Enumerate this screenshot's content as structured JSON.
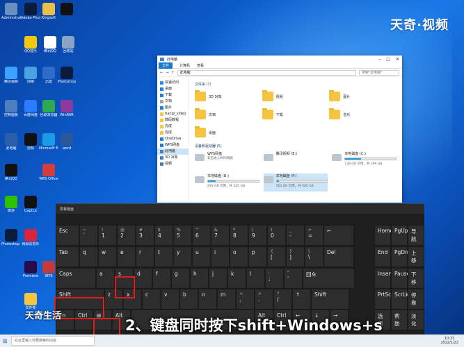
{
  "watermark": "天奇·视频",
  "caption": "2、键盘同时按下shift+Windows+s",
  "brand_logo": "天奇生活",
  "desktop_icons": [
    {
      "label": "Administrator",
      "color": "#6a8fbf"
    },
    {
      "label": "Adobe Photoshop",
      "color": "#0b1b3a"
    },
    {
      "label": "Kingsoft",
      "color": "#e8c04a"
    },
    {
      "label": "",
      "color": "#111111"
    },
    {
      "label": "QQ音乐",
      "color": "#f2c80f"
    },
    {
      "label": "腾讯QQ",
      "color": "#ffffff"
    },
    {
      "label": "回收站",
      "color": "#8aa4c4"
    },
    {
      "label": "腾讯视频",
      "color": "#3ba3ff"
    },
    {
      "label": "网络",
      "color": "#4aa3df"
    },
    {
      "label": "迅雷",
      "color": "#2f6cc9"
    },
    {
      "label": "Photoshop",
      "color": "#0b1b3a"
    },
    {
      "label": "控制面板",
      "color": "#4d7fbf"
    },
    {
      "label": "百度网盘",
      "color": "#2d7bff"
    },
    {
      "label": "谷歌浏览器",
      "color": "#2fa84f"
    },
    {
      "label": "WinRAR",
      "color": "#8a3a9c"
    },
    {
      "label": "此电脑",
      "color": "#2a5fa8"
    },
    {
      "label": "剪映",
      "color": "#111111"
    },
    {
      "label": "Microsoft Edge",
      "color": "#1a9be6"
    },
    {
      "label": "word",
      "color": "#2b579a"
    },
    {
      "label": "腾讯QQ",
      "color": "#111111"
    },
    {
      "label": "WPS Office",
      "color": "#d63c3c"
    },
    {
      "label": "CapCut",
      "color": "#111111"
    },
    {
      "label": "微信",
      "color": "#2dc100"
    },
    {
      "label": "网易云音乐",
      "color": "#d7263d"
    },
    {
      "label": "Photoshop 2020",
      "color": "#0b1b3a"
    },
    {
      "label": "Premiere",
      "color": "#2a0a4a"
    },
    {
      "label": "WPS",
      "color": "#c43a3a"
    },
    {
      "label": "文件夹",
      "color": "#f5c542"
    }
  ],
  "explorer": {
    "title": "此电脑",
    "ribbon": {
      "file": "文件",
      "computer": "计算机",
      "view": "查看"
    },
    "address": "此电脑",
    "search_placeholder": "搜索\"此电脑\"",
    "nav": [
      {
        "label": "快速访问",
        "color": "#3b8fe0"
      },
      {
        "label": "桌面",
        "color": "#2a7fd4"
      },
      {
        "label": "下载",
        "color": "#2a7fd4"
      },
      {
        "label": "文档",
        "color": "#9aa6b2"
      },
      {
        "label": "图片",
        "color": "#2a7fd4"
      },
      {
        "label": "tiangi_video",
        "color": "#f5c542"
      },
      {
        "label": "数码教程",
        "color": "#f5c542"
      },
      {
        "label": "完成",
        "color": "#f5c542"
      },
      {
        "label": "完成",
        "color": "#f5c542"
      },
      {
        "label": "OneDrive",
        "color": "#2a7fd4"
      },
      {
        "label": "WPS网盘",
        "color": "#2a7fd4"
      },
      {
        "label": "此电脑",
        "color": "#4d7fbf"
      },
      {
        "label": "3D 对象",
        "color": "#4d7fbf"
      },
      {
        "label": "视频",
        "color": "#4d7fbf"
      }
    ],
    "folders_heading": "文件夹 (7)",
    "folders": [
      "3D 对象",
      "视频",
      "图片",
      "文档",
      "下载",
      "音乐",
      "桌面"
    ],
    "drives_heading": "设备和驱动器 (5)",
    "drives": [
      {
        "name": "WPS网盘",
        "sub": "双击进入WPS网盘",
        "fill": 0
      },
      {
        "name": "腾讯视频 (E:)",
        "sub": "",
        "fill": 0
      },
      {
        "name": "本地磁盘 (C:)",
        "sub": "138 GB 可用，共 199 GB",
        "fill": 0.31
      },
      {
        "name": "本地磁盘 (D:)",
        "sub": "293 GB 可用，共 345 GB",
        "fill": 0.15
      },
      {
        "name": "本地磁盘 (F:)",
        "sub": "562 GB 可用，共 585 GB",
        "fill": 0.04
      }
    ]
  },
  "osk": {
    "title": "屏幕键盘",
    "rows": [
      [
        "Esc",
        "~ `",
        "! 1",
        "@ 2",
        "# 3",
        "$ 4",
        "% 5",
        "^ 6",
        "& 7",
        "* 8",
        "( 9",
        ") 0",
        "_ -",
        "+ =",
        "←"
      ],
      [
        "Tab",
        "q",
        "w",
        "e",
        "r",
        "t",
        "y",
        "u",
        "i",
        "o",
        "p",
        "{ [",
        "} ]",
        "| \\",
        "Del"
      ],
      [
        "Caps",
        "a",
        "s",
        "d",
        "f",
        "g",
        "h",
        "j",
        "k",
        "l",
        ": ;",
        "\" '",
        "回车"
      ],
      [
        "Shift",
        "z",
        "x",
        "c",
        "v",
        "b",
        "n",
        "m",
        "< ,",
        "> .",
        "? /",
        "↑",
        "Shift"
      ],
      [
        "Fn",
        "Ctrl",
        "⊞",
        "Alt",
        "",
        "Alt",
        "Ctrl",
        "←",
        "↓",
        "→"
      ]
    ],
    "nav_keys": [
      [
        "Home",
        "PgUp",
        "导航"
      ],
      [
        "End",
        "PgDn",
        "上移"
      ],
      [
        "Insert",
        "Pause",
        "下移"
      ],
      [
        "PrtScn",
        "ScrLk",
        "停靠"
      ],
      [
        "选项",
        "帮助",
        "淡化"
      ]
    ]
  },
  "taskbar": {
    "search_placeholder": "在这里输入你要搜索的内容",
    "time": "10:32",
    "date": "2022/1/22"
  }
}
